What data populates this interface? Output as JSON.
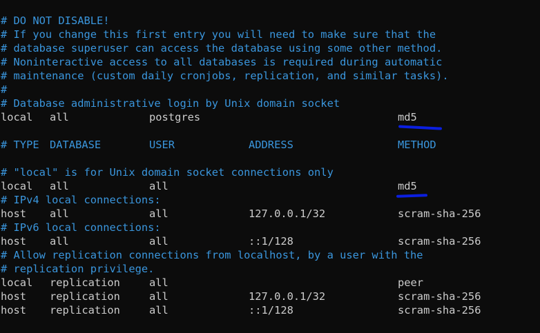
{
  "terminal": {
    "lines": {
      "l0": "# DO NOT DISABLE!",
      "l1": "# If you change this first entry you will need to make sure that the",
      "l2": "# database superuser can access the database using some other method.",
      "l3": "# Noninteractive access to all databases is required during automatic",
      "l4": "# maintenance (custom daily cronjobs, replication, and similar tasks).",
      "l5": "#",
      "l6": "# Database administrative login by Unix domain socket",
      "l8": "",
      "l13": "# \"local\" is for Unix domain socket connections only",
      "l15": "# IPv4 local connections:",
      "l17": "# IPv6 local connections:",
      "l19": "# Allow replication connections from localhost, by a user with the",
      "l20": "# replication privilege."
    },
    "header": {
      "type": "# TYPE",
      "database": "DATABASE",
      "user": "USER",
      "address": "ADDRESS",
      "method": "METHOD"
    },
    "records": [
      {
        "type": "local",
        "database": "all",
        "user": "postgres",
        "address": "",
        "method": "md5"
      },
      {
        "type": "local",
        "database": "all",
        "user": "all",
        "address": "",
        "method": "md5"
      },
      {
        "type": "host",
        "database": "all",
        "user": "all",
        "address": "127.0.0.1/32",
        "method": "scram-sha-256"
      },
      {
        "type": "host",
        "database": "all",
        "user": "all",
        "address": "::1/128",
        "method": "scram-sha-256"
      },
      {
        "type": "local",
        "database": "replication",
        "user": "all",
        "address": "",
        "method": "peer"
      },
      {
        "type": "host",
        "database": "replication",
        "user": "all",
        "address": "127.0.0.1/32",
        "method": "scram-sha-256"
      },
      {
        "type": "host",
        "database": "replication",
        "user": "all",
        "address": "::1/128",
        "method": "scram-sha-256"
      }
    ]
  },
  "colors": {
    "background": "#0c0c0c",
    "text": "#cccccc",
    "comment": "#3a96dd",
    "annotation": "#0b1fe0"
  }
}
